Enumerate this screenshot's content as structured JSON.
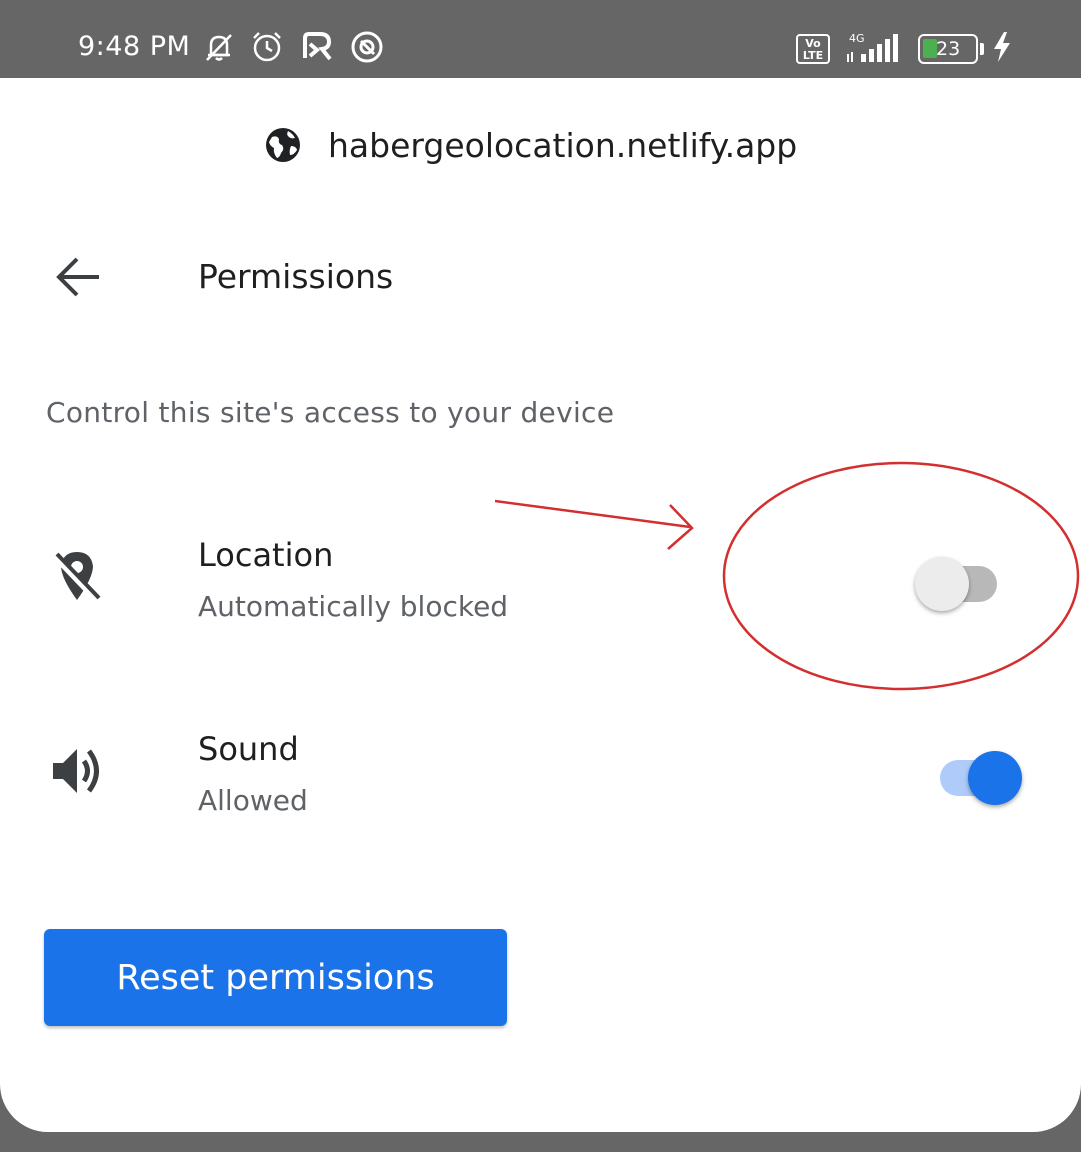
{
  "status_bar": {
    "time": "9:48 PM",
    "network_label": "4G",
    "volte_label": "Vo LTE",
    "battery_level": "23",
    "icons": [
      "bell-off-icon",
      "alarm-icon",
      "app-icon",
      "app-icon",
      "volte-icon",
      "signal-icon",
      "battery-icon",
      "charging-icon"
    ]
  },
  "site": {
    "url": "habergeolocation.netlify.app",
    "icon": "globe-icon"
  },
  "header": {
    "title": "Permissions",
    "back_icon": "arrow-left-icon"
  },
  "description": "Control this site's access to your device",
  "permissions": [
    {
      "name": "Location",
      "status": "Automatically blocked",
      "icon": "location-off-icon",
      "enabled": false
    },
    {
      "name": "Sound",
      "status": "Allowed",
      "icon": "volume-icon",
      "enabled": true
    }
  ],
  "reset_button": "Reset permissions",
  "colors": {
    "accent": "#1a73e8",
    "annotation": "#d32f2f",
    "status_bar": "#666666"
  }
}
